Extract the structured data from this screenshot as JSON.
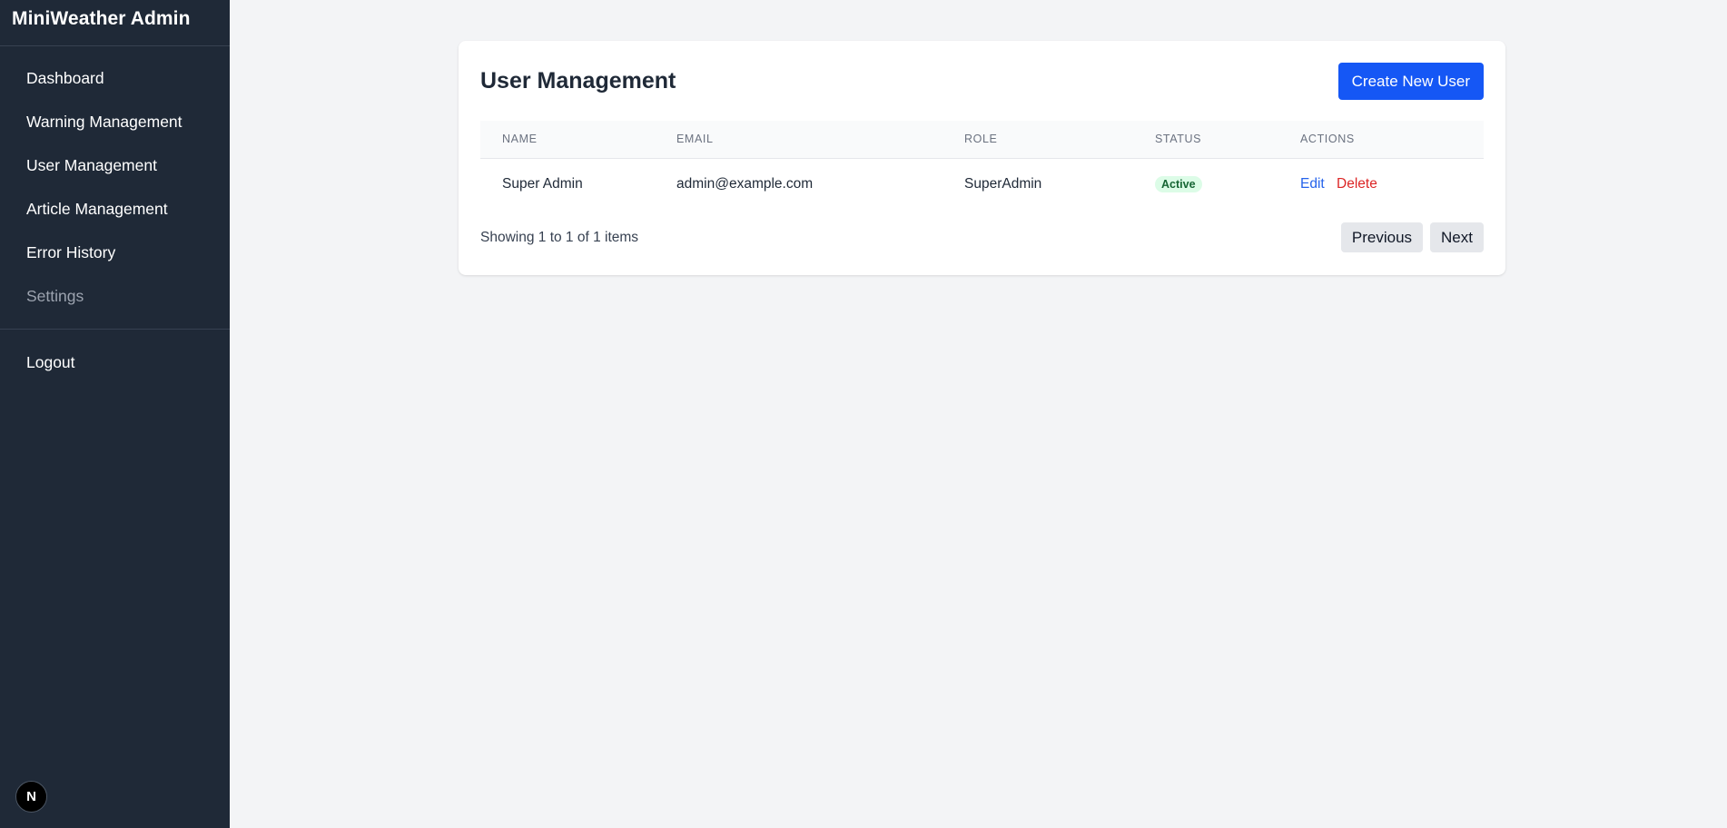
{
  "sidebar": {
    "brand": "MiniWeather Admin",
    "items": [
      {
        "label": "Dashboard"
      },
      {
        "label": "Warning Management"
      },
      {
        "label": "User Management"
      },
      {
        "label": "Article Management"
      },
      {
        "label": "Error History"
      },
      {
        "label": "Settings"
      }
    ],
    "logout_label": "Logout",
    "badge_letter": "N"
  },
  "main": {
    "title": "User Management",
    "create_button": "Create New User",
    "table": {
      "columns": [
        "NAME",
        "EMAIL",
        "ROLE",
        "STATUS",
        "ACTIONS"
      ],
      "rows": [
        {
          "name": "Super Admin",
          "email": "admin@example.com",
          "role": "SuperAdmin",
          "status": "Active",
          "edit": "Edit",
          "delete": "Delete"
        }
      ]
    },
    "footer": {
      "summary": "Showing 1 to 1 of 1 items",
      "previous": "Previous",
      "next": "Next"
    }
  },
  "colors": {
    "sidebar_bg": "#1f2937",
    "primary": "#1557f5",
    "danger": "#dc2626",
    "status_active_bg": "#dcfce7",
    "status_active_fg": "#166534"
  }
}
